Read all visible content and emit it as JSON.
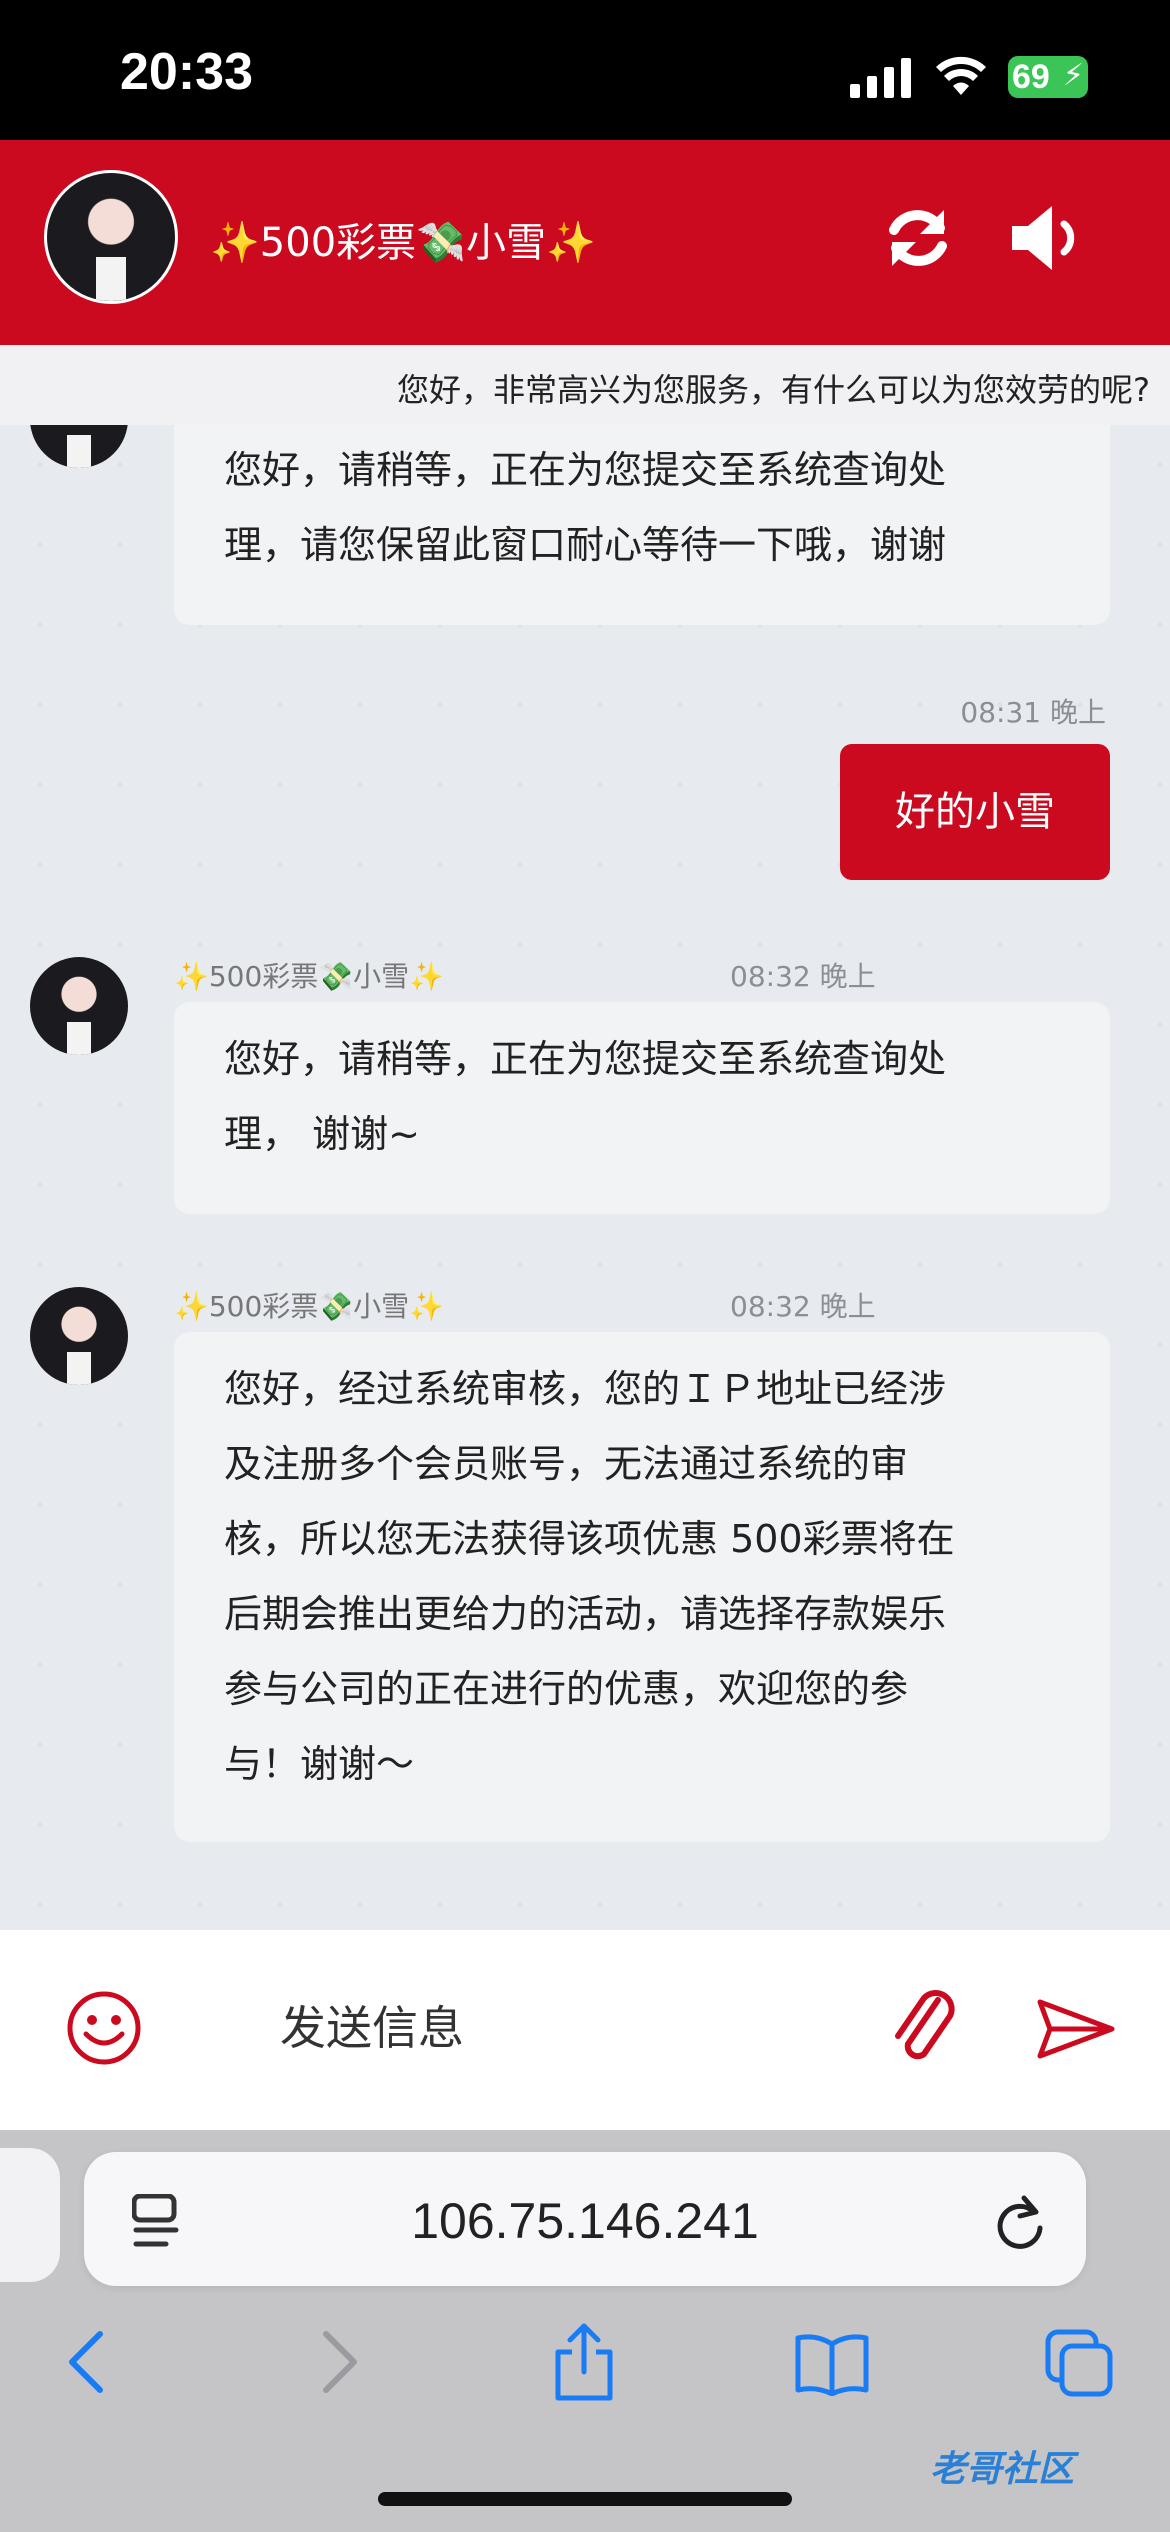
{
  "status_bar": {
    "time": "20:33",
    "battery": "69"
  },
  "header": {
    "title": "✨500彩票💸小雪✨"
  },
  "marquee": {
    "text": "您好，非常高兴为您服务，有什么可以为您效劳的呢?"
  },
  "messages": [
    {
      "type": "received",
      "text_line1": "您好，请稍等，正在为您提交至系统查询处",
      "text_line2": "理，请您保留此窗口耐心等待一下哦，谢谢"
    },
    {
      "type": "sent",
      "time": "08:31 晚上",
      "text": "好的小雪"
    },
    {
      "type": "received",
      "sender": "✨500彩票💸小雪✨",
      "time": "08:32 晚上",
      "text_line1": "您好，请稍等，正在为您提交至系统查询处",
      "text_line2": "理， 谢谢~"
    },
    {
      "type": "received",
      "sender": "✨500彩票💸小雪✨",
      "time": "08:32 晚上",
      "lines": [
        "您好，经过系统审核，您的ＩＰ地址已经涉",
        "及注册多个会员账号，无法通过系统的审",
        "核，所以您无法获得该项优惠 500彩票将在",
        "后期会推出更给力的活动，请选择存款娱乐",
        "参与公司的正在进行的优惠，欢迎您的参",
        "与！谢谢～"
      ]
    }
  ],
  "input": {
    "placeholder": "发送信息"
  },
  "browser": {
    "url": "106.75.146.241"
  },
  "watermark": "老哥社区",
  "colors": {
    "brand_red": "#cc0a1f",
    "ios_blue": "#1a7cf5"
  }
}
